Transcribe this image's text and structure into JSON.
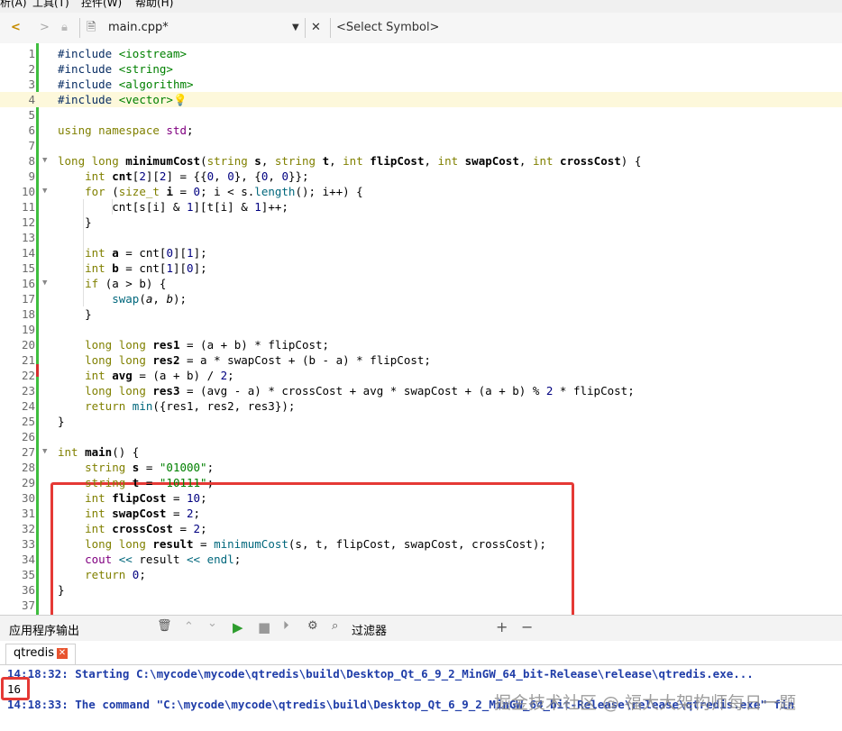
{
  "menubar": {
    "items": [
      "析(A)",
      "工具(T)",
      "控件(W)",
      "帮助(H)"
    ]
  },
  "toolbar": {
    "back": "<",
    "forward": ">",
    "file": "main.cpp*",
    "close": "✕",
    "symbol": "<Select Symbol>"
  },
  "editor": {
    "lines": [
      {
        "n": "1",
        "html": "<span class='pa'>#include</span> <span class='st'>&lt;iostream&gt;</span>"
      },
      {
        "n": "2",
        "html": "<span class='pa'>#include</span> <span class='st'>&lt;string&gt;</span>"
      },
      {
        "n": "3",
        "html": "<span class='pa'>#include</span> <span class='st'>&lt;algorithm&gt;</span>"
      },
      {
        "n": "4",
        "html": "<span class='pa'>#include</span> <span class='st'>&lt;vector&gt;</span><span style='color:#e6b800'>💡</span>"
      },
      {
        "n": "5",
        "html": ""
      },
      {
        "n": "6",
        "html": "<span class='kw'>using namespace</span> <span style='color:#800080'>std</span>;"
      },
      {
        "n": "7",
        "html": ""
      },
      {
        "n": "8",
        "html": "<span class='ty'>long long</span> <span class='b'>minimumCost</span>(<span class='ty'>string</span> <span class='b'>s</span>, <span class='ty'>string</span> <span class='b'>t</span>, <span class='ty'>int</span> <span class='b'>flipCost</span>, <span class='ty'>int</span> <span class='b'>swapCost</span>, <span class='ty'>int</span> <span class='b'>crossCost</span>) {"
      },
      {
        "n": "9",
        "html": "    <span class='ty'>int</span> <span class='b'>cnt</span>[<span class='nm'>2</span>][<span class='nm'>2</span>] = {{<span class='nm'>0</span>, <span class='nm'>0</span>}, {<span class='nm'>0</span>, <span class='nm'>0</span>}};"
      },
      {
        "n": "10",
        "html": "    <span class='kw'>for</span> (<span class='ty'>size_t</span> <span class='b'>i</span> = <span class='nm'>0</span>; i &lt; s.<span class='fn'>length</span>(); i++) {"
      },
      {
        "n": "11",
        "html": "        cnt[s[i] &amp; <span class='nm'>1</span>][t[i] &amp; <span class='nm'>1</span>]++;"
      },
      {
        "n": "12",
        "html": "    }"
      },
      {
        "n": "13",
        "html": ""
      },
      {
        "n": "14",
        "html": "    <span class='ty'>int</span> <span class='b'>a</span> = cnt[<span class='nm'>0</span>][<span class='nm'>1</span>];"
      },
      {
        "n": "15",
        "html": "    <span class='ty'>int</span> <span class='b'>b</span> = cnt[<span class='nm'>1</span>][<span class='nm'>0</span>];"
      },
      {
        "n": "16",
        "html": "    <span class='kw'>if</span> (a &gt; b) {"
      },
      {
        "n": "17",
        "html": "        <span class='fn'>swap</span>(<i>a</i>, <i>b</i>);"
      },
      {
        "n": "18",
        "html": "    }"
      },
      {
        "n": "19",
        "html": ""
      },
      {
        "n": "20",
        "html": "    <span class='ty'>long long</span> <span class='b'>res1</span> = (a + b) * flipCost;"
      },
      {
        "n": "21",
        "html": "    <span class='ty'>long long</span> <span class='b'>res2</span> = a * swapCost + (b - a) * flipCost;"
      },
      {
        "n": "22",
        "html": "    <span class='ty'>int</span> <span class='b'>avg</span> = (a + b) / <span class='nm'>2</span>;"
      },
      {
        "n": "23",
        "html": "    <span class='ty'>long long</span> <span class='b'>res3</span> = (avg - a) * crossCost + avg * swapCost + (a + b) % <span class='nm'>2</span> * flipCost;"
      },
      {
        "n": "24",
        "html": "    <span class='kw'>return</span> <span class='fn'>min</span>({res1, res2, res3});"
      },
      {
        "n": "25",
        "html": "}"
      },
      {
        "n": "26",
        "html": ""
      },
      {
        "n": "27",
        "html": "<span class='ty'>int</span> <span class='b'>main</span>() {"
      },
      {
        "n": "28",
        "html": "    <span class='ty'>string</span> <span class='b'>s</span> = <span class='st'>\"01000\"</span>;"
      },
      {
        "n": "29",
        "html": "    <span class='ty'>string</span> <span class='b'>t</span> = <span class='st'>\"10111\"</span>;"
      },
      {
        "n": "30",
        "html": "    <span class='ty'>int</span> <span class='b'>flipCost</span> = <span class='nm'>10</span>;"
      },
      {
        "n": "31",
        "html": "    <span class='ty'>int</span> <span class='b'>swapCost</span> = <span class='nm'>2</span>;"
      },
      {
        "n": "32",
        "html": "    <span class='ty'>int</span> <span class='b'>crossCost</span> = <span class='nm'>2</span>;"
      },
      {
        "n": "33",
        "html": "    <span class='ty'>long long</span> <span class='b'>result</span> = <span class='fn'>minimumCost</span>(s, t, flipCost, swapCost, crossCost);"
      },
      {
        "n": "34",
        "html": "    <span style='color:#800080'>cout</span> <span class='fn'>&lt;&lt;</span> result <span class='fn'>&lt;&lt;</span> <span class='fn'>endl</span>;"
      },
      {
        "n": "35",
        "html": "    <span class='kw'>return</span> <span class='nm'>0</span>;"
      },
      {
        "n": "36",
        "html": "}"
      },
      {
        "n": "37",
        "html": ""
      }
    ]
  },
  "output": {
    "header_title": "应用程序输出",
    "filter_label": "过滤器",
    "plus": "+",
    "minus": "−",
    "tab_label": "qtredis",
    "lines": [
      "14:18:32: Starting C:\\mycode\\mycode\\qtredis\\build\\Desktop_Qt_6_9_2_MinGW_64_bit-Release\\release\\qtredis.exe...",
      "16",
      "14:18:33: The command \"C:\\mycode\\mycode\\qtredis\\build\\Desktop_Qt_6_9_2_MinGW_64_bit-Release\\release\\qtredis.exe\" fin"
    ]
  },
  "watermark": "掘金技术社区 @ 福大大架构师每日一题",
  "colors": {
    "change_bar": "#3fbe3f",
    "highlight_box": "#e53935",
    "output_blue": "#1f3da8"
  }
}
